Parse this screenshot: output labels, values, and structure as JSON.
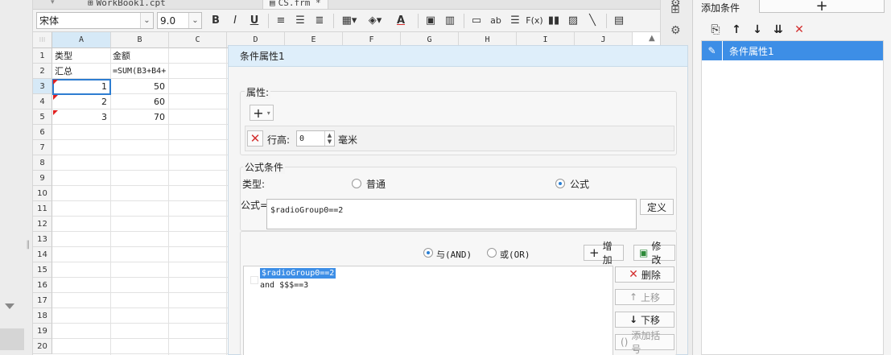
{
  "tabs": [
    {
      "label": "WorkBook1.cpt"
    },
    {
      "label": "CS.frm *"
    }
  ],
  "toolbar": {
    "font_family": "宋体",
    "font_size": "9.0",
    "bold": "B",
    "italic": "I",
    "underline": "U",
    "text_color_letter": "A",
    "colors": {
      "text_color_bar": "#d32f2f"
    }
  },
  "sheet": {
    "columns": [
      "A",
      "B",
      "C",
      "D",
      "E",
      "F",
      "G",
      "H",
      "I",
      "J"
    ],
    "rows": [
      "1",
      "2",
      "3",
      "4",
      "5",
      "6",
      "7",
      "8",
      "9",
      "10",
      "11",
      "12",
      "13",
      "14",
      "15",
      "16",
      "17",
      "18",
      "19",
      "20"
    ],
    "cells": {
      "A1": "类型",
      "B1": "金额",
      "A2": "汇总",
      "B2": "=SUM(B3+B4+",
      "A3": "1",
      "B3": "50",
      "A4": "2",
      "B4": "60",
      "A5": "3",
      "B5": "70"
    }
  },
  "dialog": {
    "title": "条件属性1",
    "property_label": "属性:",
    "row_height_label": "行高:",
    "row_height_value": "0",
    "row_height_unit": "毫米",
    "formula_section_label": "公式条件",
    "type_label": "类型:",
    "type_normal": "普通",
    "type_formula": "公式",
    "formula_label": "公式=",
    "formula_value": "$radioGroup0==2",
    "define_button": "定义",
    "and_label": "与(AND)",
    "or_label": "或(OR)",
    "add_button": "增加",
    "modify_button": "修改",
    "condition_lines": [
      "$radioGroup0==2",
      "and $$$==3"
    ],
    "delete_button": "删除",
    "move_up_button": "上移",
    "move_down_button": "下移",
    "add_bracket_button": "添加括号"
  },
  "right_panel": {
    "title": "添加条件",
    "add_symbol": "+",
    "items": [
      {
        "label": "条件属性1"
      }
    ]
  }
}
